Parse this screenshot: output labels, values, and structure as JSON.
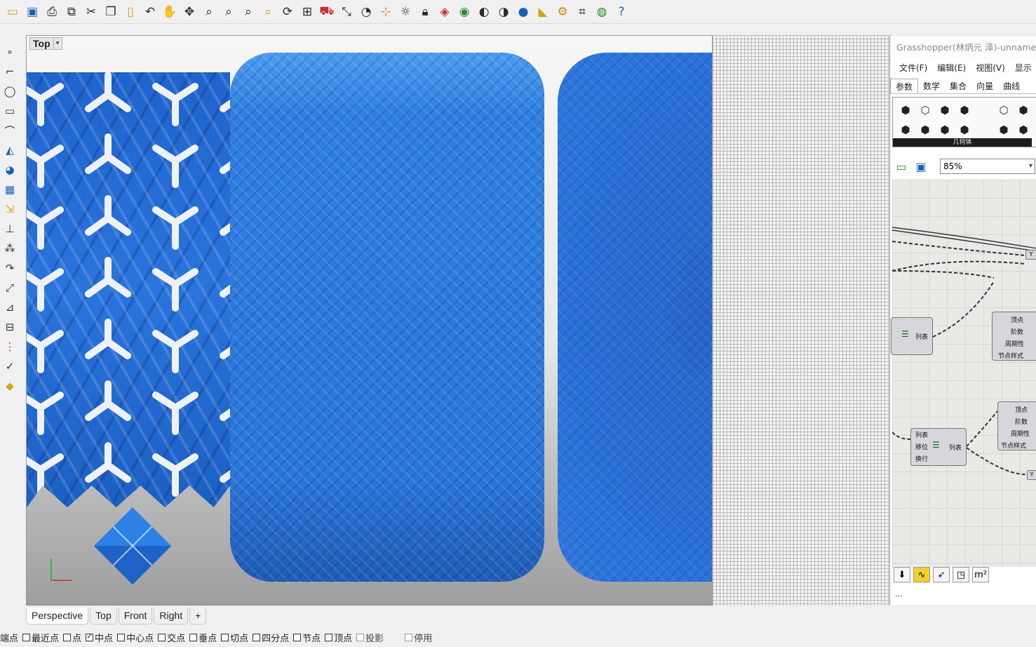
{
  "toolbar_top": {
    "icons": [
      "open-folder-icon",
      "save-icon",
      "print-icon",
      "import-icon",
      "cut-icon",
      "copy-icon",
      "paste-icon",
      "undo-icon",
      "pan-hand-icon",
      "move-view-icon",
      "zoom-icon",
      "zoom-window-icon",
      "zoom-extents-icon",
      "zoom-selected-icon",
      "rotate-view-icon",
      "four-viewports-icon",
      "car-icon",
      "dim-icon",
      "history-icon",
      "snap-icon",
      "light-icon",
      "lock-icon",
      "layer-icon",
      "color-wheel-icon",
      "shaded-sphere-icon",
      "rendered-sphere-icon",
      "blue-sphere-icon",
      "render-icon",
      "gear-icon",
      "options-icon",
      "grasshopper-icon",
      "help-icon"
    ]
  },
  "toolbar_left": {
    "icons": [
      "point-icon",
      "polyline-icon",
      "circle-icon",
      "rectangle-icon",
      "curve-icon",
      "surface-icon",
      "solid-icon",
      "mesh-icon",
      "transform-icon",
      "dimension-icon",
      "group-icon",
      "curve-tools-icon",
      "snap-tools-icon",
      "edit-icon",
      "analyze-icon",
      "section-icon",
      "check-icon",
      "paint-icon"
    ]
  },
  "viewport": {
    "label": "Top",
    "label_arrow": "▾"
  },
  "viewport_tabs": [
    "Perspective",
    "Top",
    "Front",
    "Right",
    "+"
  ],
  "osnap": [
    {
      "label": "端点",
      "checked": false,
      "disabled": false
    },
    {
      "label": "最近点",
      "checked": false,
      "disabled": false
    },
    {
      "label": "点",
      "checked": false,
      "disabled": false
    },
    {
      "label": "中点",
      "checked": true,
      "disabled": false
    },
    {
      "label": "中心点",
      "checked": false,
      "disabled": false
    },
    {
      "label": "交点",
      "checked": false,
      "disabled": false
    },
    {
      "label": "垂点",
      "checked": false,
      "disabled": false
    },
    {
      "label": "切点",
      "checked": false,
      "disabled": false
    },
    {
      "label": "四分点",
      "checked": false,
      "disabled": false
    },
    {
      "label": "节点",
      "checked": false,
      "disabled": false
    },
    {
      "label": "顶点",
      "checked": false,
      "disabled": false
    },
    {
      "label": "投影",
      "checked": false,
      "disabled": true
    },
    {
      "label": "停用",
      "checked": false,
      "disabled": true
    }
  ],
  "grasshopper": {
    "title": "Grasshopper(林炳元 泽)-unnamed",
    "menu": [
      "文件(F)",
      "编辑(E)",
      "视图(V)",
      "显示"
    ],
    "tabs": [
      "参数",
      "数学",
      "集合",
      "向量",
      "曲线"
    ],
    "ribbon_label": "几何体",
    "zoom": "85%",
    "nodes": {
      "list_node_1": {
        "label": "列表"
      },
      "spline_node_1": {
        "pins": [
          "顶点",
          "阶数",
          "周期性",
          "节点样式"
        ]
      },
      "spline_node_2": {
        "pins": [
          "顶点",
          "阶数",
          "周期性",
          "节点样式"
        ]
      },
      "shift_node": {
        "pins": [
          "列表",
          "移位",
          "换行"
        ],
        "out": "列表"
      }
    },
    "panel_y": "Y",
    "status": "..."
  }
}
